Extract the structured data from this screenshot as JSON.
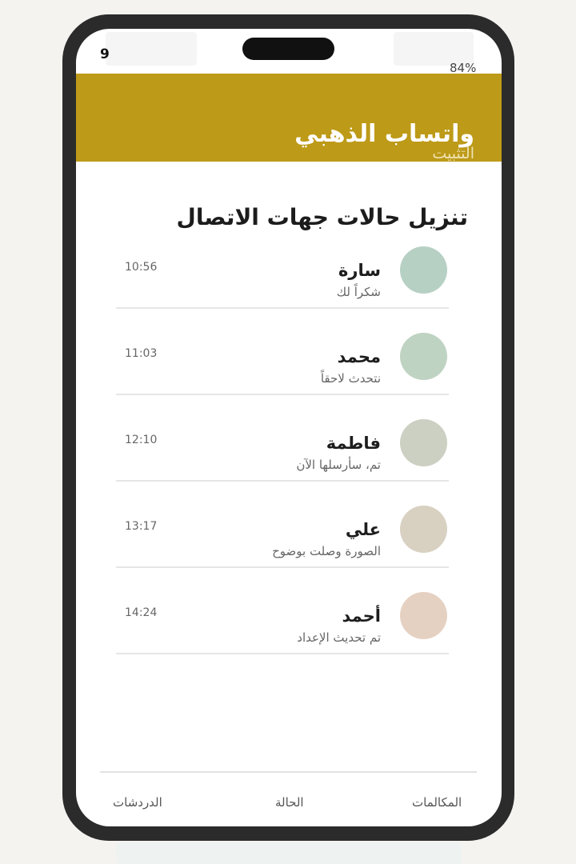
{
  "status_bar": {
    "left_text": "9",
    "right_text": "84%"
  },
  "header": {
    "title": "واتساب الذهبي",
    "subtitle": "التثبيت"
  },
  "main": {
    "title": "تنزيل حالات جهات الاتصال"
  },
  "chats": [
    {
      "name": "سارة",
      "message": "شكراً لك",
      "time": "10:56",
      "avatar_color": "#b7d0c4"
    },
    {
      "name": "محمد",
      "message": "نتحدث لاحقاً",
      "time": "11:03",
      "avatar_color": "#bfd3c2"
    },
    {
      "name": "فاطمة",
      "message": "تم، سأرسلها الآن",
      "time": "12:10",
      "avatar_color": "#ccd0c2"
    },
    {
      "name": "علي",
      "message": "الصورة وصلت بوضوح",
      "time": "13:17",
      "avatar_color": "#d8d1c2"
    },
    {
      "name": "أحمد",
      "message": "تم تحديث الإعداد",
      "time": "14:24",
      "avatar_color": "#e5d1c2"
    }
  ],
  "bottom_nav": {
    "chats": "الدردشات",
    "status": "الحالة",
    "calls": "المكالمات"
  },
  "colors": {
    "header_bg": "#bd9a18",
    "phone_frame": "#2b2b2b"
  }
}
